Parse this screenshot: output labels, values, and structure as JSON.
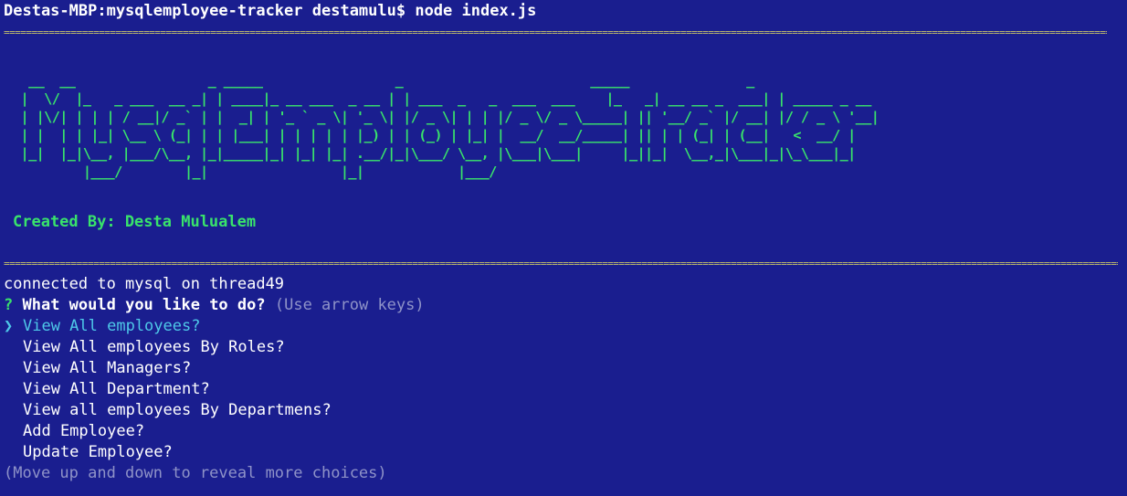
{
  "terminal": {
    "background": "#1a1e8f",
    "command_prompt": "Destas-MBP:mysqlemployee-tracker destamulu$ node index.js",
    "separator": "==================================================================================================================================================================================================================================================================",
    "banner": [
      "  __  __                 _ _____                 _                        _____               _             ",
      " |  \\/  |_   _ ___  __ _| | ____|_ __ ___  _ __ | | ___  _   _  ___  ___    |_   _| __ __ _  ___| | _____ _ __ ",
      " | |\\/| | | | / __|/ _` | |  _| | '_ ` _ \\| '_ \\| |/ _ \\| | | |/ _ \\/ _ \\_____| || '__/ _` |/ __| |/ / _ \\ '__|",
      " | |  | | |_| \\__ \\ (_| | | |___| | | | | | |_) | | (_) | |_| |  __/  __/_____| || | | (_| | (__|   <  __/ |   ",
      " |_|  |_|\\__, |___/\\__, |_|_____|_| |_| |_| .__/|_|\\___/ \\__, |\\___|\\___|     |_||_|  \\__,_|\\___|_|\\_\\___|_|   ",
      "         |___/        |_|                 |_|            |___/                                                  "
    ],
    "credit": "Created By: Desta Mulualem",
    "connected": "connected to mysql on thread49",
    "question": {
      "mark": "?",
      "text": "What would you like to do?",
      "hint": "(Use arrow keys)"
    },
    "pointer": "❯",
    "choices": [
      "View All employees?",
      "View All employees By Roles?",
      "View All Managers?",
      "View All Department?",
      "View all employees By Departmens?",
      "Add Employee?",
      "Update Employee?"
    ],
    "more_hint": "(Move up and down to reveal more choices)"
  }
}
